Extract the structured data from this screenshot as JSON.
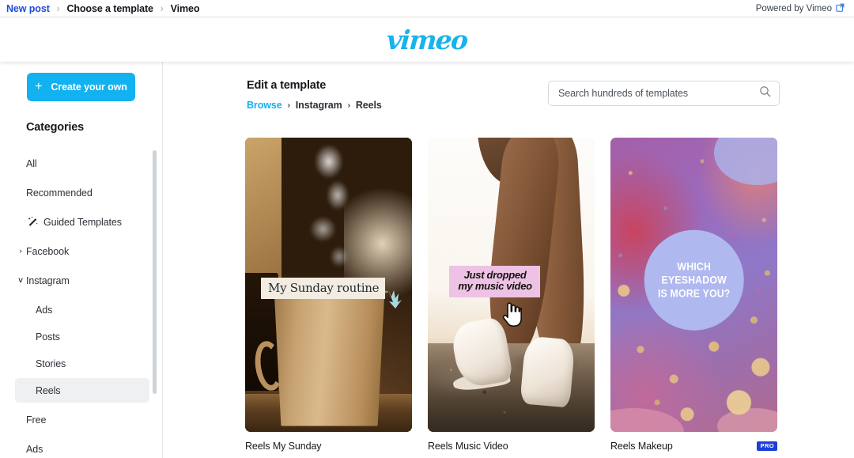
{
  "topbar": {
    "breadcrumbs": [
      {
        "label": "New post",
        "is_link": true
      },
      {
        "label": "Choose a template",
        "is_link": false
      },
      {
        "label": "Vimeo",
        "is_link": false
      }
    ],
    "separator": "›",
    "powered_by": "Powered by Vimeo",
    "external_icon": "external-link-icon"
  },
  "brand": {
    "logo_text": "vimeo",
    "logo_color": "#17b3ec"
  },
  "sidebar": {
    "create_button": {
      "label": "Create your own",
      "plus": "+",
      "color": "#12b1ef"
    },
    "categories_title": "Categories",
    "items": [
      {
        "label": "All",
        "level": 0,
        "arrow": "",
        "active": false,
        "icon": ""
      },
      {
        "label": "Recommended",
        "level": 0,
        "arrow": "",
        "active": false,
        "icon": ""
      },
      {
        "label": "Guided Templates",
        "level": 0,
        "arrow": "",
        "active": false,
        "icon": "magic-wand-icon"
      },
      {
        "label": "Facebook",
        "level": 0,
        "arrow": "›",
        "active": false,
        "icon": ""
      },
      {
        "label": "Instagram",
        "level": 0,
        "arrow": "∨",
        "active": false,
        "icon": ""
      },
      {
        "label": "Ads",
        "level": 1,
        "arrow": "",
        "active": false,
        "icon": ""
      },
      {
        "label": "Posts",
        "level": 1,
        "arrow": "",
        "active": false,
        "icon": ""
      },
      {
        "label": "Stories",
        "level": 1,
        "arrow": "",
        "active": false,
        "icon": ""
      },
      {
        "label": "Reels",
        "level": 1,
        "arrow": "",
        "active": true,
        "icon": ""
      },
      {
        "label": "Free",
        "level": 0,
        "arrow": "",
        "active": false,
        "icon": ""
      },
      {
        "label": "Ads",
        "level": 0,
        "arrow": "",
        "active": false,
        "icon": ""
      }
    ]
  },
  "main": {
    "title": "Edit a template",
    "breadcrumbs": [
      {
        "label": "Browse",
        "is_link": true
      },
      {
        "label": "Instagram",
        "is_link": false
      },
      {
        "label": "Reels",
        "is_link": false
      }
    ],
    "separator": "›",
    "search": {
      "placeholder": "Search hundreds of templates",
      "value": "",
      "icon": "search-icon"
    },
    "cards": [
      {
        "title": "Reels My Sunday",
        "overlay_text": "My Sunday routine",
        "pro": false,
        "pro_label": ""
      },
      {
        "title": "Reels Music Video",
        "overlay_line1": "Just dropped",
        "overlay_line2": "my music video",
        "pro": false,
        "pro_label": ""
      },
      {
        "title": "Reels Makeup",
        "overlay_line1": "WHICH",
        "overlay_line2": "EYESHADOW",
        "overlay_line3": "IS MORE YOU?",
        "pro": true,
        "pro_label": "PRO"
      }
    ]
  }
}
